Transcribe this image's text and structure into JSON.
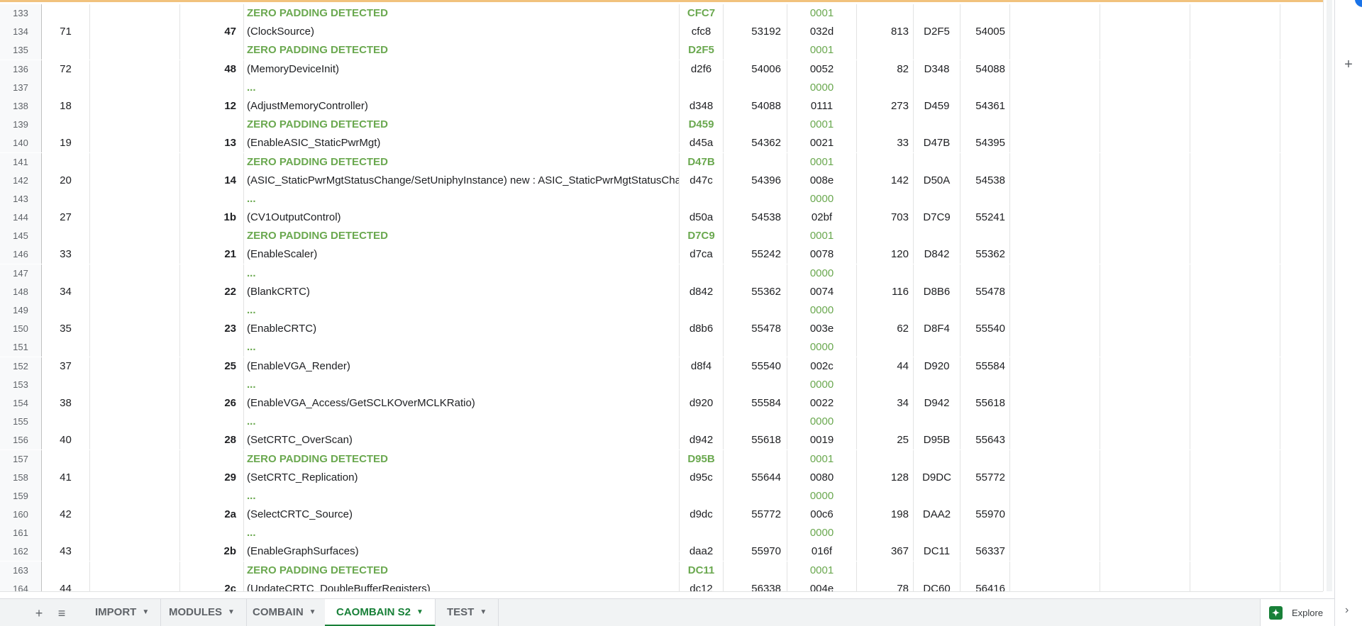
{
  "grid": {
    "rows": [
      {
        "num": "133",
        "a": "",
        "c": "",
        "d": "ZERO PADDING DETECTED",
        "e": "CFC7",
        "f": "",
        "g": "0001",
        "h": "",
        "i": "",
        "j": "",
        "kind": "zero"
      },
      {
        "num": "134",
        "a": "71",
        "c": "47",
        "d": "(ClockSource)",
        "e": "cfc8",
        "f": "53192",
        "g": "032d",
        "h": "813",
        "i": "D2F5",
        "j": "54005",
        "kind": "data"
      },
      {
        "num": "135",
        "a": "",
        "c": "",
        "d": "ZERO PADDING DETECTED",
        "e": "D2F5",
        "f": "",
        "g": "0001",
        "h": "",
        "i": "",
        "j": "",
        "kind": "zero"
      },
      {
        "num": "136",
        "a": "72",
        "c": "48",
        "d": "(MemoryDeviceInit)",
        "e": "d2f6",
        "f": "54006",
        "g": "0052",
        "h": "82",
        "i": "D348",
        "j": "54088",
        "kind": "data"
      },
      {
        "num": "137",
        "a": "",
        "c": "",
        "d": "...",
        "e": "",
        "f": "",
        "g": "0000",
        "h": "",
        "i": "",
        "j": "",
        "kind": "dots"
      },
      {
        "num": "138",
        "a": "18",
        "c": "12",
        "d": "(AdjustMemoryController)",
        "e": "d348",
        "f": "54088",
        "g": "0111",
        "h": "273",
        "i": "D459",
        "j": "54361",
        "kind": "data"
      },
      {
        "num": "139",
        "a": "",
        "c": "",
        "d": "ZERO PADDING DETECTED",
        "e": "D459",
        "f": "",
        "g": "0001",
        "h": "",
        "i": "",
        "j": "",
        "kind": "zero"
      },
      {
        "num": "140",
        "a": "19",
        "c": "13",
        "d": "(EnableASIC_StaticPwrMgt)",
        "e": "d45a",
        "f": "54362",
        "g": "0021",
        "h": "33",
        "i": "D47B",
        "j": "54395",
        "kind": "data"
      },
      {
        "num": "141",
        "a": "",
        "c": "",
        "d": "ZERO PADDING DETECTED",
        "e": "D47B",
        "f": "",
        "g": "0001",
        "h": "",
        "i": "",
        "j": "",
        "kind": "zero"
      },
      {
        "num": "142",
        "a": "20",
        "c": "14",
        "d": "(ASIC_StaticPwrMgtStatusChange/SetUniphyInstance) new :  ASIC_StaticPwrMgtStatusCha",
        "e": "d47c",
        "f": "54396",
        "g": "008e",
        "h": "142",
        "i": "D50A",
        "j": "54538",
        "kind": "data"
      },
      {
        "num": "143",
        "a": "",
        "c": "",
        "d": "...",
        "e": "",
        "f": "",
        "g": "0000",
        "h": "",
        "i": "",
        "j": "",
        "kind": "dots"
      },
      {
        "num": "144",
        "a": "27",
        "c": "1b",
        "d": "(CV1OutputControl)",
        "e": "d50a",
        "f": "54538",
        "g": "02bf",
        "h": "703",
        "i": "D7C9",
        "j": "55241",
        "kind": "data"
      },
      {
        "num": "145",
        "a": "",
        "c": "",
        "d": "ZERO PADDING DETECTED",
        "e": "D7C9",
        "f": "",
        "g": "0001",
        "h": "",
        "i": "",
        "j": "",
        "kind": "zero"
      },
      {
        "num": "146",
        "a": "33",
        "c": "21",
        "d": "(EnableScaler)",
        "e": "d7ca",
        "f": "55242",
        "g": "0078",
        "h": "120",
        "i": "D842",
        "j": "55362",
        "kind": "data"
      },
      {
        "num": "147",
        "a": "",
        "c": "",
        "d": "...",
        "e": "",
        "f": "",
        "g": "0000",
        "h": "",
        "i": "",
        "j": "",
        "kind": "dots"
      },
      {
        "num": "148",
        "a": "34",
        "c": "22",
        "d": "(BlankCRTC)",
        "e": "d842",
        "f": "55362",
        "g": "0074",
        "h": "116",
        "i": "D8B6",
        "j": "55478",
        "kind": "data"
      },
      {
        "num": "149",
        "a": "",
        "c": "",
        "d": "...",
        "e": "",
        "f": "",
        "g": "0000",
        "h": "",
        "i": "",
        "j": "",
        "kind": "dots"
      },
      {
        "num": "150",
        "a": "35",
        "c": "23",
        "d": "(EnableCRTC)",
        "e": "d8b6",
        "f": "55478",
        "g": "003e",
        "h": "62",
        "i": "D8F4",
        "j": "55540",
        "kind": "data"
      },
      {
        "num": "151",
        "a": "",
        "c": "",
        "d": "...",
        "e": "",
        "f": "",
        "g": "0000",
        "h": "",
        "i": "",
        "j": "",
        "kind": "dots"
      },
      {
        "num": "152",
        "a": "37",
        "c": "25",
        "d": "(EnableVGA_Render)",
        "e": "d8f4",
        "f": "55540",
        "g": "002c",
        "h": "44",
        "i": "D920",
        "j": "55584",
        "kind": "data"
      },
      {
        "num": "153",
        "a": "",
        "c": "",
        "d": "...",
        "e": "",
        "f": "",
        "g": "0000",
        "h": "",
        "i": "",
        "j": "",
        "kind": "dots"
      },
      {
        "num": "154",
        "a": "38",
        "c": "26",
        "d": "(EnableVGA_Access/GetSCLKOverMCLKRatio)",
        "e": "d920",
        "f": "55584",
        "g": "0022",
        "h": "34",
        "i": "D942",
        "j": "55618",
        "kind": "data"
      },
      {
        "num": "155",
        "a": "",
        "c": "",
        "d": "...",
        "e": "",
        "f": "",
        "g": "0000",
        "h": "",
        "i": "",
        "j": "",
        "kind": "dots"
      },
      {
        "num": "156",
        "a": "40",
        "c": "28",
        "d": "(SetCRTC_OverScan)",
        "e": "d942",
        "f": "55618",
        "g": "0019",
        "h": "25",
        "i": "D95B",
        "j": "55643",
        "kind": "data"
      },
      {
        "num": "157",
        "a": "",
        "c": "",
        "d": "ZERO PADDING DETECTED",
        "e": "D95B",
        "f": "",
        "g": "0001",
        "h": "",
        "i": "",
        "j": "",
        "kind": "zero"
      },
      {
        "num": "158",
        "a": "41",
        "c": "29",
        "d": "(SetCRTC_Replication)",
        "e": "d95c",
        "f": "55644",
        "g": "0080",
        "h": "128",
        "i": "D9DC",
        "j": "55772",
        "kind": "data"
      },
      {
        "num": "159",
        "a": "",
        "c": "",
        "d": "...",
        "e": "",
        "f": "",
        "g": "0000",
        "h": "",
        "i": "",
        "j": "",
        "kind": "dots"
      },
      {
        "num": "160",
        "a": "42",
        "c": "2a",
        "d": "(SelectCRTC_Source)",
        "e": "d9dc",
        "f": "55772",
        "g": "00c6",
        "h": "198",
        "i": "DAA2",
        "j": "55970",
        "kind": "data"
      },
      {
        "num": "161",
        "a": "",
        "c": "",
        "d": "...",
        "e": "",
        "f": "",
        "g": "0000",
        "h": "",
        "i": "",
        "j": "",
        "kind": "dots"
      },
      {
        "num": "162",
        "a": "43",
        "c": "2b",
        "d": "(EnableGraphSurfaces)",
        "e": "daa2",
        "f": "55970",
        "g": "016f",
        "h": "367",
        "i": "DC11",
        "j": "56337",
        "kind": "data"
      },
      {
        "num": "163",
        "a": "",
        "c": "",
        "d": "ZERO PADDING DETECTED",
        "e": "DC11",
        "f": "",
        "g": "0001",
        "h": "",
        "i": "",
        "j": "",
        "kind": "zero"
      },
      {
        "num": "164",
        "a": "44",
        "c": "2c",
        "d": "(UpdateCRTC_DoubleBufferRegisters)",
        "e": "dc12",
        "f": "56338",
        "g": "004e",
        "h": "78",
        "i": "DC60",
        "j": "56416",
        "kind": "data"
      }
    ]
  },
  "tabbar": {
    "add_icon": "plus-icon",
    "list_icon": "list-icon",
    "tabs": [
      {
        "label": "IMPORT",
        "active": false
      },
      {
        "label": "MODULES",
        "active": false
      },
      {
        "label": "COMBAIN",
        "active": false
      },
      {
        "label": "CAOMBAIN S2",
        "active": true
      },
      {
        "label": "TEST",
        "active": false
      }
    ],
    "explore_label": "Explore"
  },
  "side_panel": {
    "icons": [
      "edit-badge-icon",
      "plus-icon"
    ]
  },
  "colors": {
    "accent_bar": "#f1c27d",
    "green_text": "#6aa84f",
    "active_tab": "#188038"
  }
}
